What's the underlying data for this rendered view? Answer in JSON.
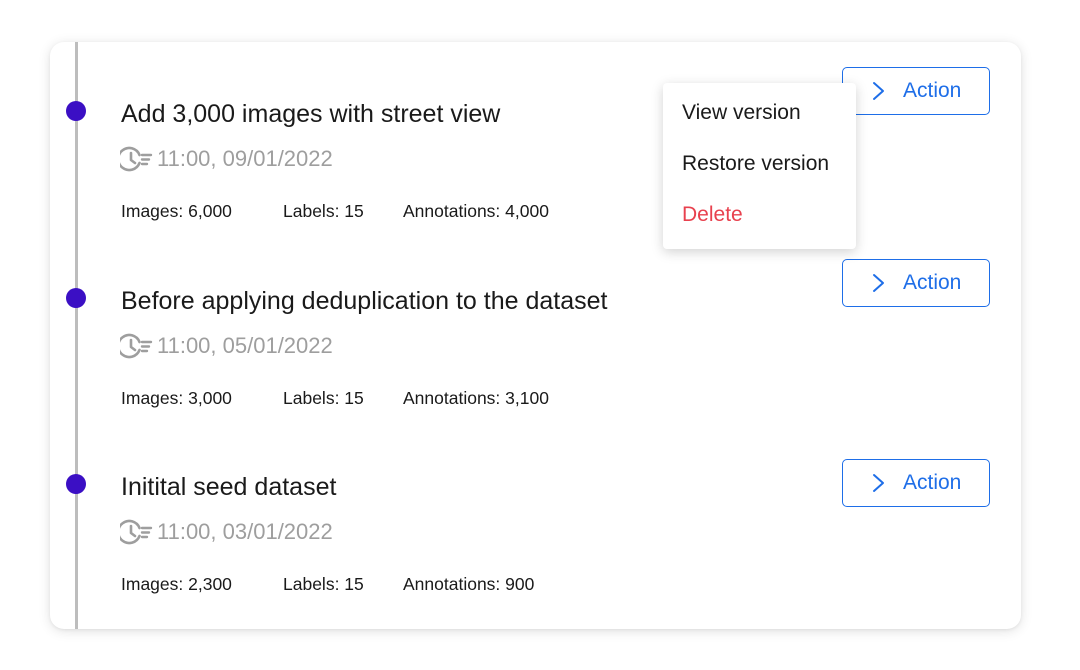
{
  "entries": [
    {
      "title": "Add 3,000 images with street view",
      "timestamp": "11:00, 09/01/2022",
      "images": "Images: 6,000",
      "labels": "Labels: 15",
      "annotations": "Annotations: 4,000",
      "action_label": "Action"
    },
    {
      "title": "Before applying deduplication to the dataset",
      "timestamp": "11:00, 05/01/2022",
      "images": "Images: 3,000",
      "labels": "Labels: 15",
      "annotations": "Annotations: 3,100",
      "action_label": "Action"
    },
    {
      "title": "Initital seed dataset",
      "timestamp": "11:00, 03/01/2022",
      "images": "Images: 2,300",
      "labels": "Labels: 15",
      "annotations": "Annotations: 900",
      "action_label": "Action"
    }
  ],
  "menu": {
    "items": [
      {
        "label": "View version",
        "color": "#1a1a1a"
      },
      {
        "label": "Restore version",
        "color": "#1a1a1a"
      },
      {
        "label": "Delete",
        "color": "#e8414e"
      }
    ]
  },
  "colors": {
    "dot": "#3b0fc4",
    "accent": "#1e6ee8",
    "timeline": "#bdbdbd",
    "muted_text": "#9e9e9e",
    "danger": "#e8414e"
  },
  "icons": {
    "timestamp": "clock-icon",
    "action": "chevron-right-icon"
  }
}
